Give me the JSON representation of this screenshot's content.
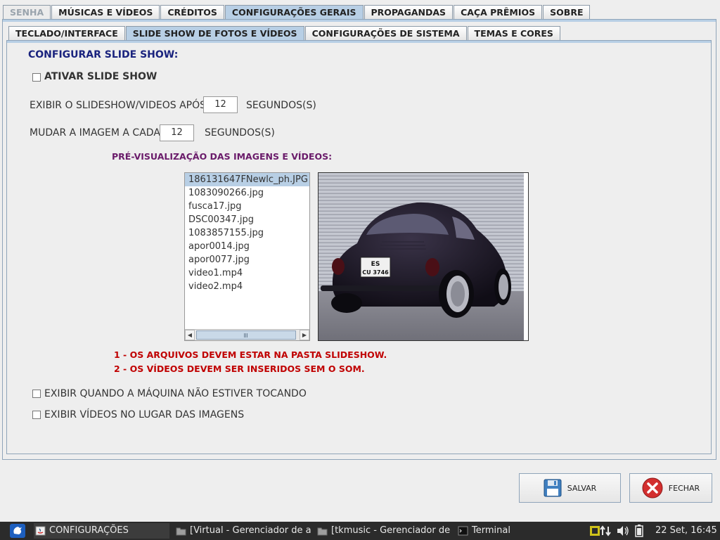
{
  "top_tabs": [
    {
      "label": "SENHA",
      "state": "disabled"
    },
    {
      "label": "MÚSICAS E VÍDEOS",
      "state": "normal"
    },
    {
      "label": "CRÉDITOS",
      "state": "normal"
    },
    {
      "label": "CONFIGURAÇÕES GERAIS",
      "state": "active"
    },
    {
      "label": "PROPAGANDAS",
      "state": "normal"
    },
    {
      "label": "CAÇA PRÊMIOS",
      "state": "normal"
    },
    {
      "label": "SOBRE",
      "state": "normal"
    }
  ],
  "sub_tabs": [
    {
      "label": "TECLADO/INTERFACE",
      "state": "normal"
    },
    {
      "label": "SLIDE SHOW DE FOTOS E VÍDEOS",
      "state": "active"
    },
    {
      "label": "CONFIGURAÇÕES DE SISTEMA",
      "state": "normal"
    },
    {
      "label": "TEMAS E CORES",
      "state": "normal"
    }
  ],
  "slideshow": {
    "title": "CONFIGURAR SLIDE SHOW:",
    "activate_label": "ATIVAR SLIDE SHOW",
    "activate_checked": false,
    "show_after_label": "EXIBIR O SLIDESHOW/VIDEOS APÓS",
    "show_after_value": "12",
    "show_after_unit": "SEGUNDOS(S)",
    "change_image_label": "MUDAR A IMAGEM A CADA",
    "change_image_value": "12",
    "change_image_unit": "SEGUNDOS(S)",
    "preview_title": "PRÉ-VISUALIZAÇÃO DAS IMAGENS E VÍDEOS:",
    "files": [
      "186131647FNewlc_ph.JPG",
      "1083090266.jpg",
      "fusca17.jpg",
      "DSC00347.jpg",
      "1083857155.jpg",
      "apor0014.jpg",
      "apor0077.jpg",
      "video1.mp4",
      "video2.mp4"
    ],
    "selected_index": 0,
    "plate_line1": "ES",
    "plate_line2": "CU 3746",
    "note1": "1 - OS ARQUIVOS DEVEM ESTAR NA PASTA SLIDESHOW.",
    "note2": "2 - OS VÍDEOS DEVEM SER INSERIDOS SEM O SOM.",
    "idle_label": "EXIBIR QUANDO A MÁQUINA NÃO ESTIVER TOCANDO",
    "idle_checked": false,
    "videos_label": "EXIBIR VÍDEOS NO LUGAR DAS IMAGENS",
    "videos_checked": false
  },
  "buttons": {
    "save_label": "SALVAR",
    "close_label": "FECHAR"
  },
  "taskbar": {
    "tasks": [
      {
        "label": "CONFIGURAÇÕES",
        "icon": "java-app-icon",
        "active": true
      },
      {
        "label": "[Virtual - Gerenciador de ar...",
        "icon": "folder-icon",
        "active": false
      },
      {
        "label": "[tkmusic - Gerenciador de ...",
        "icon": "folder-icon",
        "active": false
      },
      {
        "label": "Terminal",
        "icon": "terminal-icon",
        "active": false
      }
    ],
    "clock": "22 Set, 16:45"
  },
  "colors": {
    "tab_active": "#b8cfe5",
    "heading_blue": "#1a237e",
    "heading_purple": "#6a1b6a",
    "note_red": "#c00000",
    "taskbar_bg": "#2b2b2b"
  }
}
